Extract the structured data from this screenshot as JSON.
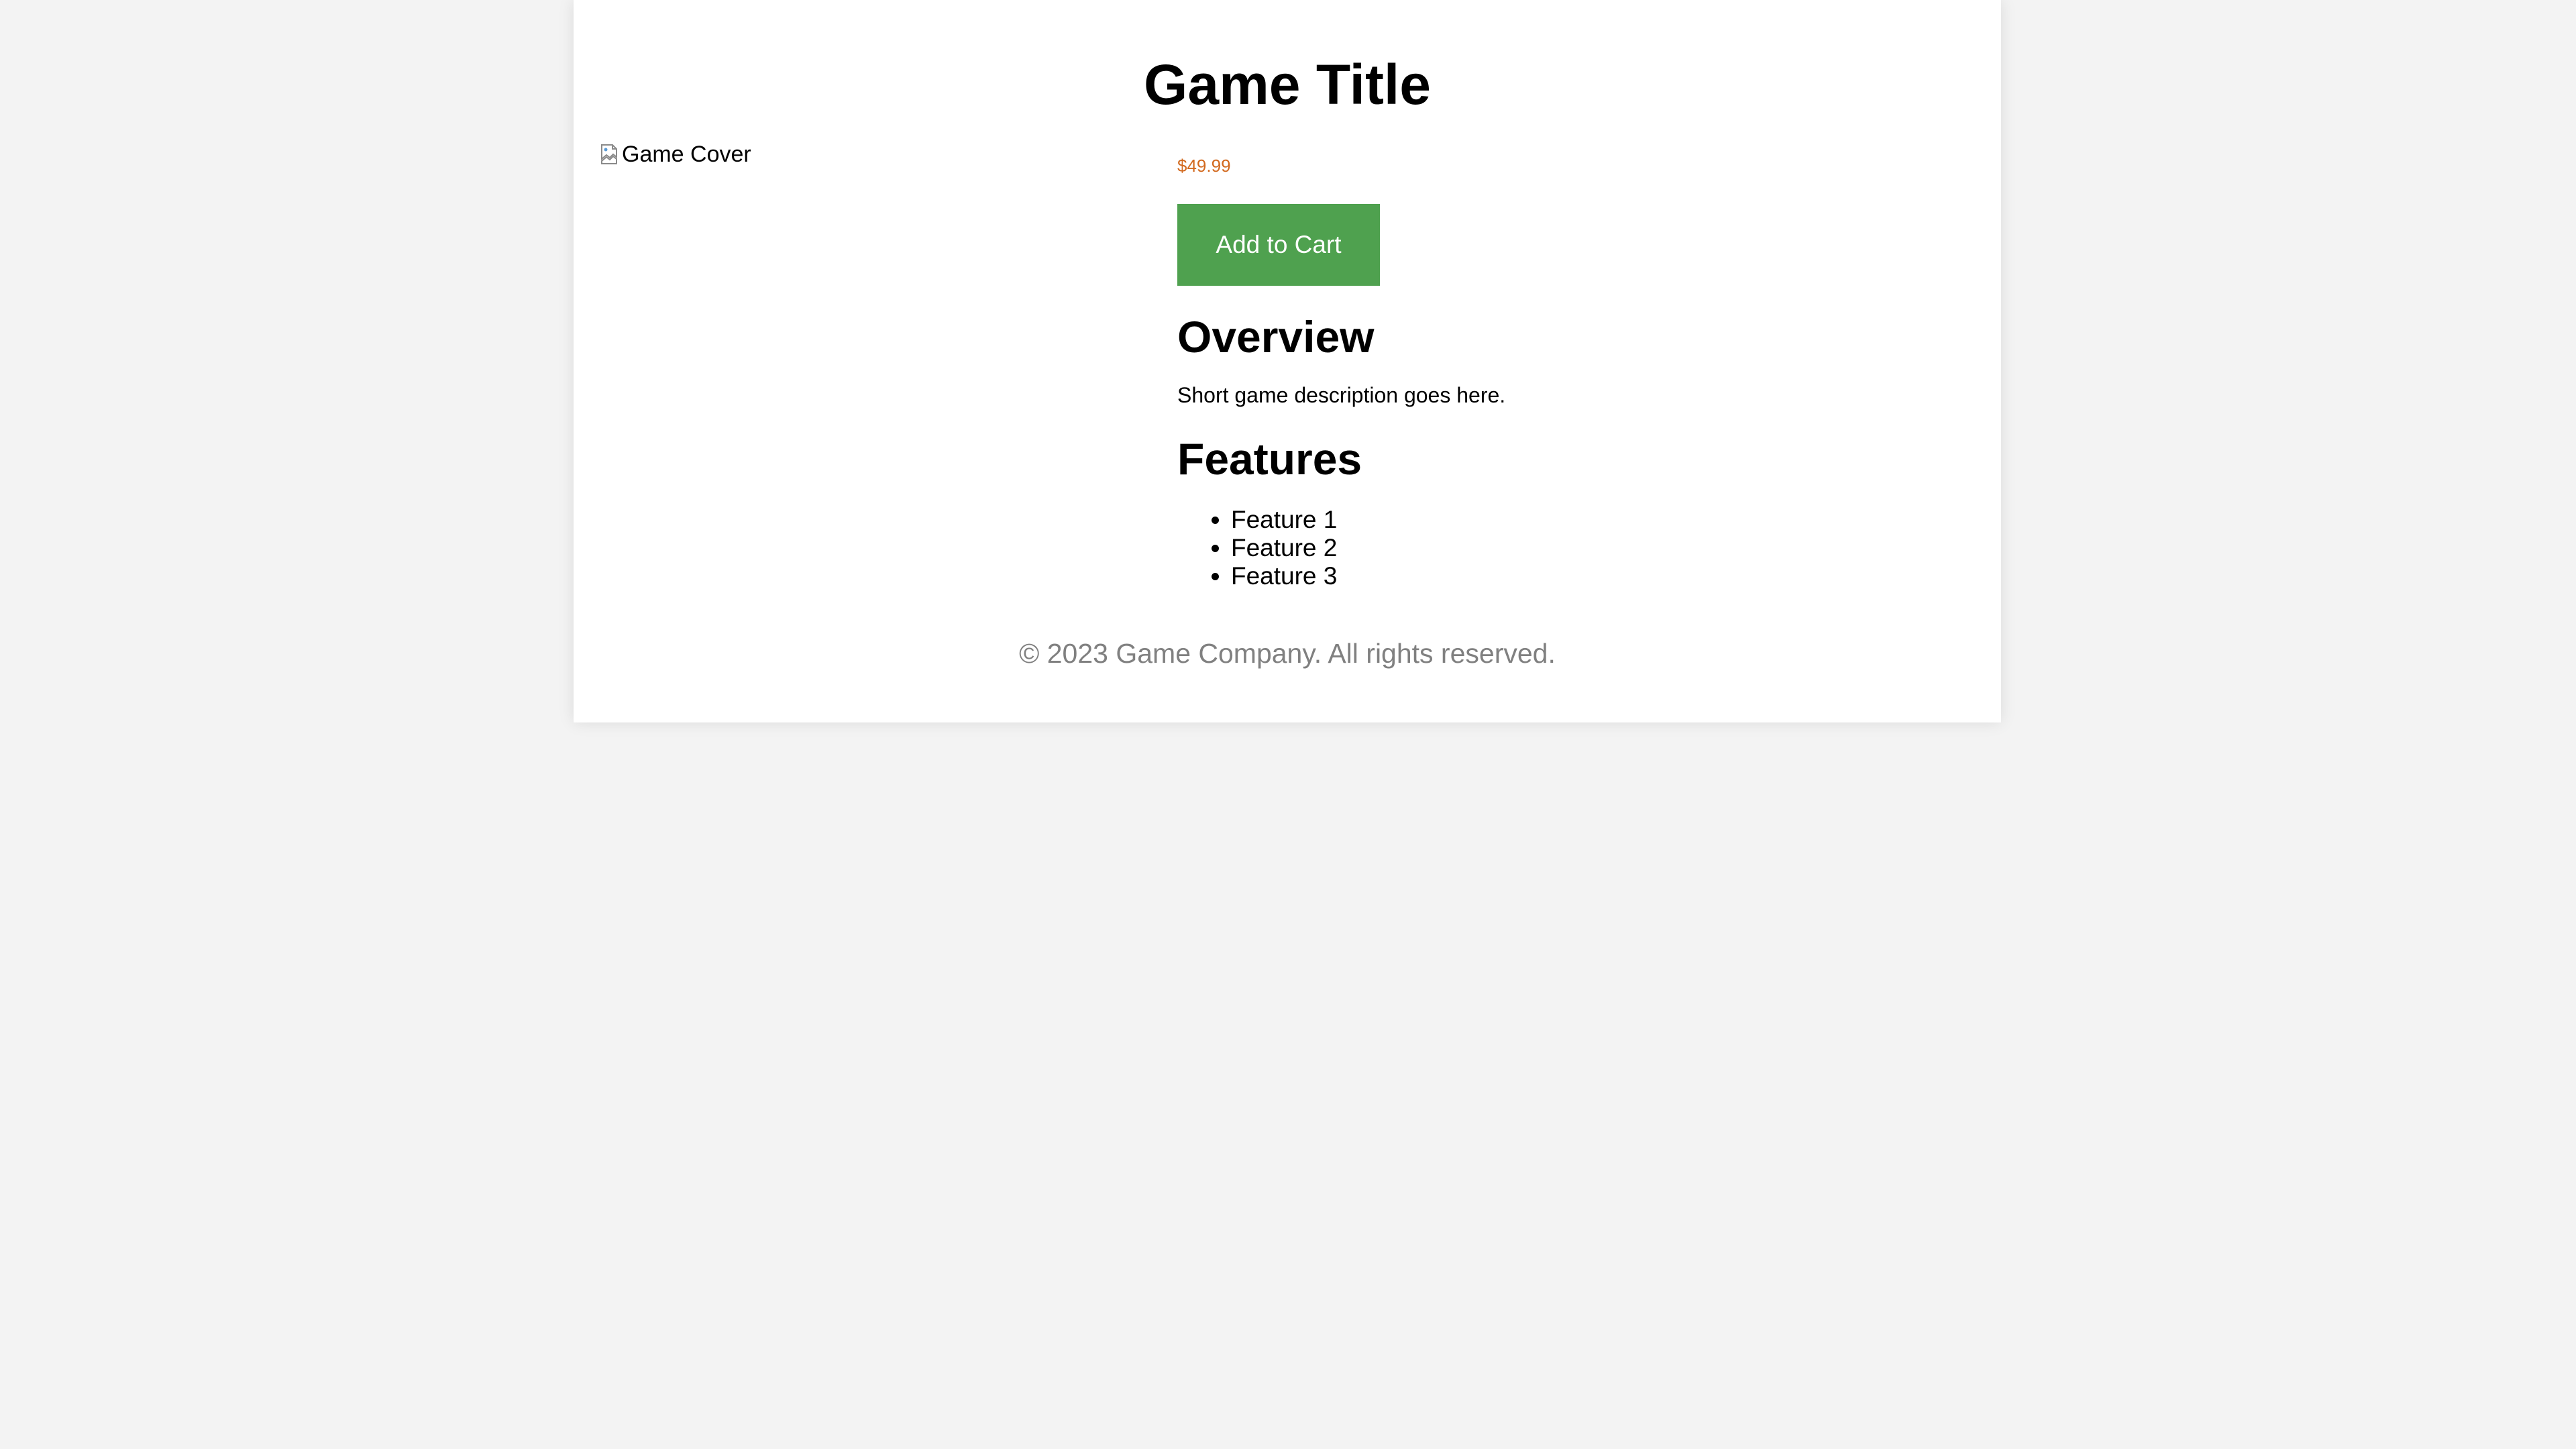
{
  "header": {
    "title": "Game Title"
  },
  "cover": {
    "alt_text": "Game Cover",
    "icon": "broken-image-icon"
  },
  "purchase": {
    "price": "$49.99",
    "add_to_cart_label": "Add to Cart"
  },
  "overview": {
    "heading": "Overview",
    "description": "Short game description goes here."
  },
  "features": {
    "heading": "Features",
    "items": [
      "Feature 1",
      "Feature 2",
      "Feature 3"
    ]
  },
  "footer": {
    "copyright": "© 2023 Game Company. All rights reserved."
  },
  "colors": {
    "price": "#d2691e",
    "button_bg": "#4fa14f",
    "footer_text": "#808080"
  }
}
